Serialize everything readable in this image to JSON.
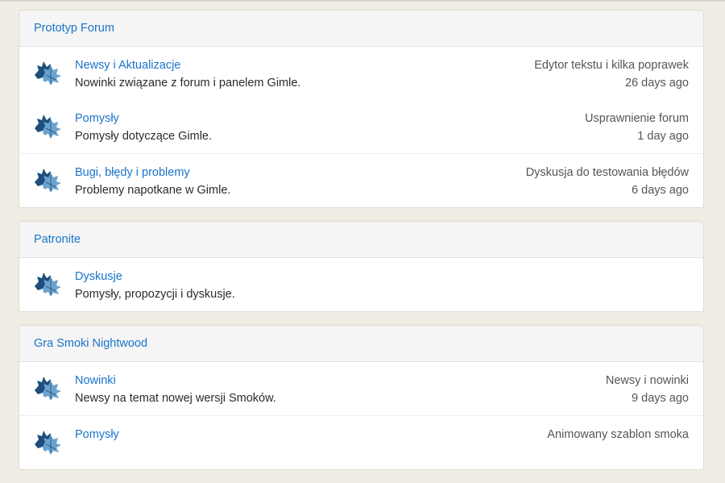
{
  "colors": {
    "link": "#1a73c9",
    "icon_dark": "#1d4f7a",
    "icon_light": "#6aa3cf"
  },
  "categories": [
    {
      "title": "Prototyp Forum",
      "forums": [
        {
          "icon": "maple-leaf-icon",
          "name": "Newsy i Aktualizacje",
          "description": "Nowinki związane z forum i panelem Gimle.",
          "last_topic": "Edytor tekstu i kilka poprawek",
          "last_time": "26 days ago"
        },
        {
          "icon": "maple-leaf-icon",
          "name": "Pomysły",
          "description": "Pomysły dotyczące Gimle.",
          "last_topic": "Usprawnienie forum",
          "last_time": "1 day ago"
        },
        {
          "icon": "maple-leaf-icon",
          "name": "Bugi, błędy i problemy",
          "description": "Problemy napotkane w Gimle.",
          "last_topic": "Dyskusja do testowania błędów",
          "last_time": "6 days ago"
        }
      ]
    },
    {
      "title": "Patronite",
      "forums": [
        {
          "icon": "maple-leaf-icon",
          "name": "Dyskusje",
          "description": "Pomysły, propozycji i dyskusje.",
          "last_topic": "",
          "last_time": ""
        }
      ]
    },
    {
      "title": "Gra Smoki Nightwood",
      "forums": [
        {
          "icon": "maple-leaf-icon",
          "name": "Nowinki",
          "description": "Newsy na temat nowej wersji Smoków.",
          "last_topic": "Newsy i nowinki",
          "last_time": "9 days ago"
        },
        {
          "icon": "maple-leaf-icon",
          "name": "Pomysły",
          "description": "",
          "last_topic": "Animowany szablon smoka",
          "last_time": ""
        }
      ]
    }
  ]
}
